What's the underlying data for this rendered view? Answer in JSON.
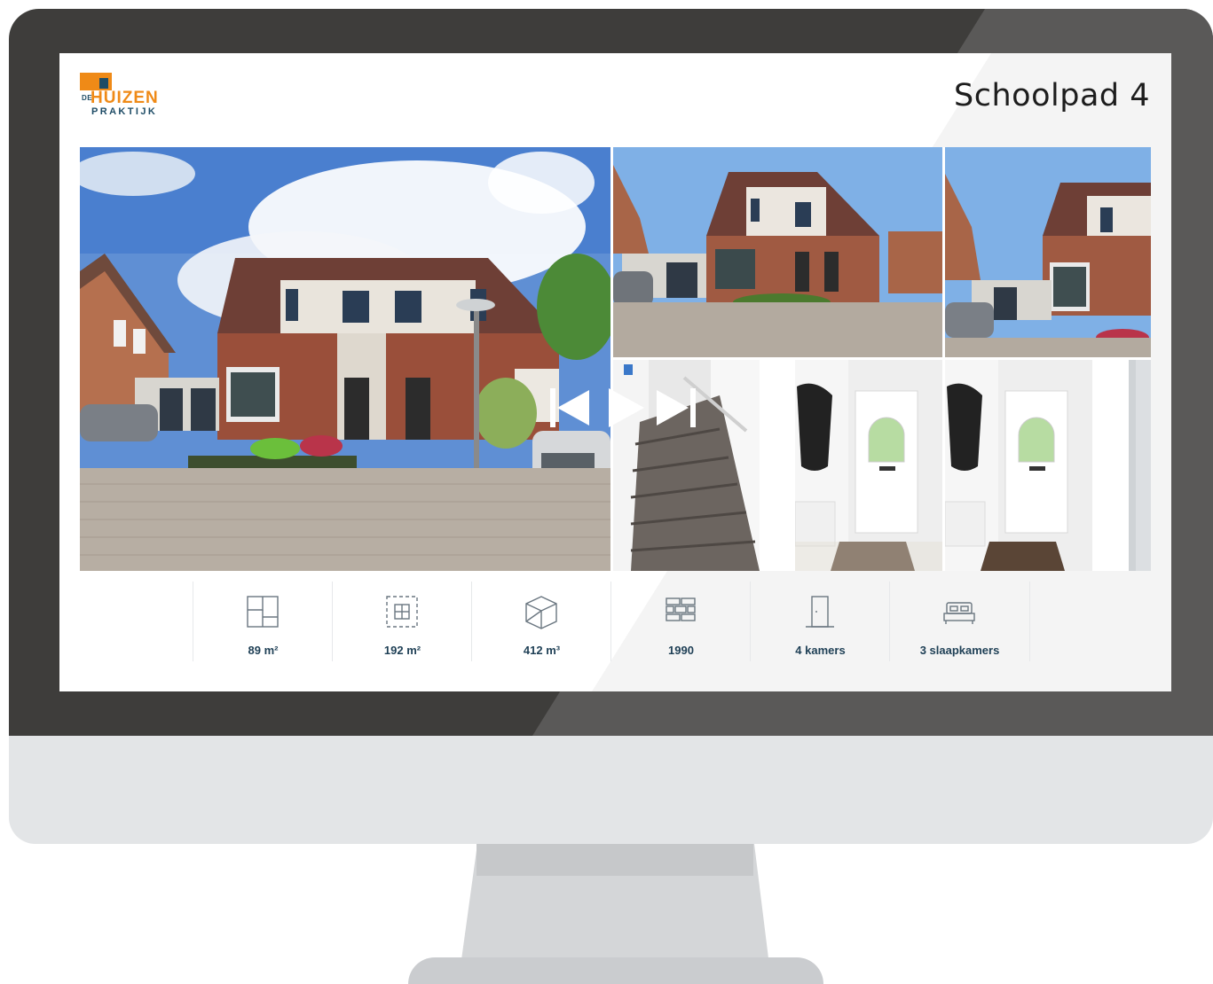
{
  "logo": {
    "de": "DE",
    "huizen": "HUIZEN",
    "praktijk": "PRAKTIJK"
  },
  "listing": {
    "address": "Schoolpad 4"
  },
  "gallery": {
    "photos": [
      {
        "name": "house-front-wide"
      },
      {
        "name": "house-front-left"
      },
      {
        "name": "house-front-right"
      },
      {
        "name": "staircase"
      },
      {
        "name": "hallway-front-door"
      },
      {
        "name": "hallway-front-door-2"
      },
      {
        "name": "partial-interior"
      }
    ],
    "controls": {
      "first": "skip-back-icon",
      "play": "play-icon",
      "last": "skip-forward-icon"
    }
  },
  "stats": [
    {
      "icon": "floor-plan-icon",
      "label": "89 m²"
    },
    {
      "icon": "plot-area-icon",
      "label": "192 m²"
    },
    {
      "icon": "volume-cube-icon",
      "label": "412 m³"
    },
    {
      "icon": "brick-wall-icon",
      "label": "1990"
    },
    {
      "icon": "door-icon",
      "label": "4 kamers"
    },
    {
      "icon": "bed-icon",
      "label": "3 slaapkamers"
    }
  ],
  "colors": {
    "brand_orange": "#ef8a17",
    "brand_blue": "#1e4c66",
    "stat_text": "#1e3f55",
    "bezel": "#3e3d3b"
  }
}
